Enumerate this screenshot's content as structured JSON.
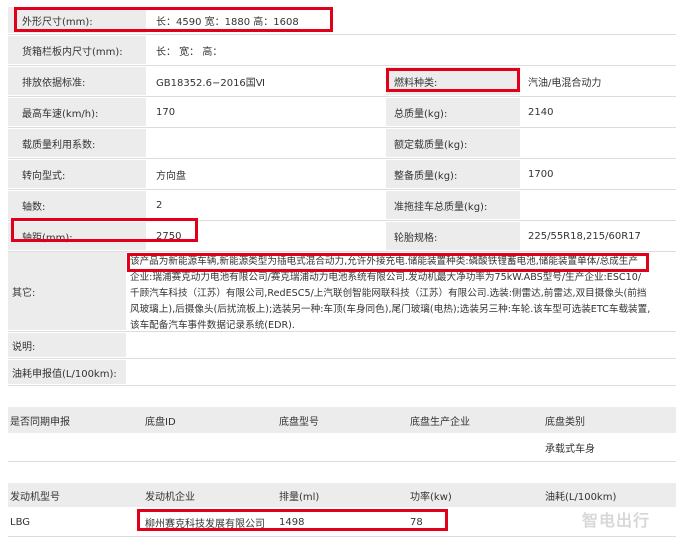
{
  "spec": {
    "dimensions": {
      "label": "外形尺寸(mm):",
      "value": "长：4590 宽：1880 高：1608"
    },
    "cargo_box": {
      "label": "货箱栏板内尺寸(mm):",
      "value": "长：  宽：  高："
    },
    "emission_std": {
      "label": "排放依据标准:",
      "value": "GB18352.6−2016国Ⅵ"
    },
    "fuel_type": {
      "label": "燃料种类:",
      "value": "汽油/电混合动力"
    },
    "max_speed": {
      "label": "最高车速(km/h):",
      "value": "170"
    },
    "total_mass": {
      "label": "总质量(kg):",
      "value": "2140"
    },
    "load_coef": {
      "label": "载质量利用系数:",
      "value": ""
    },
    "rated_load": {
      "label": "额定载质量(kg):",
      "value": ""
    },
    "steering": {
      "label": "转向型式:",
      "value": "方向盘"
    },
    "curb_mass": {
      "label": "整备质量(kg):",
      "value": "1700"
    },
    "axles": {
      "label": "轴数:",
      "value": "2"
    },
    "trailer_mass": {
      "label": "准拖挂车总质量(kg):",
      "value": ""
    },
    "wheelbase": {
      "label": "轴距(mm):",
      "value": "2750"
    },
    "tires": {
      "label": "轮胎规格:",
      "value": "225/55R18,215/60R17"
    }
  },
  "other": {
    "label": "其它:",
    "lines": [
      "该产品为新能源车辆,新能源类型为插电式混合动力,允许外接充电.储能装置种类:磷酸铁锂蓄电池,储能装置单体/总成生产",
      "企业:瑞浦赛克动力电池有限公司/赛克瑞浦动力电池系统有限公司.发动机最大净功率为75kW.ABS型号/生产企业:ESC10/",
      "千顾汽车科技（江苏）有限公司,RedESC5/上汽联创智能网联科技（江苏）有限公司.选装:侧雷达,前雷达,双目摄像头(前挡",
      "风玻璃上),后摄像头(后扰流板上);选装另一种:车顶(车身同色),尾门玻璃(电热);选装另三种:车轮.该车型可选装ETC车载装置,",
      "该车配备汽车事件数据记录系统(EDR)."
    ]
  },
  "notes": {
    "label": "说明:",
    "value": ""
  },
  "fuel_consumption": {
    "label": "油耗申报值(L/100km):",
    "value": ""
  },
  "chassis": {
    "headers": [
      "是否同期申报",
      "底盘ID",
      "底盘型号",
      "底盘生产企业",
      "底盘类别"
    ],
    "row": [
      "",
      "",
      "",
      "",
      "承载式车身"
    ]
  },
  "engine": {
    "headers": [
      "发动机型号",
      "发动机企业",
      "排量(ml)",
      "功率(kw)",
      "油耗(L/100km)"
    ],
    "row": [
      "LBG",
      "柳州赛克科技发展有限公司",
      "1498",
      "78",
      ""
    ]
  },
  "watermark": "智电出行"
}
